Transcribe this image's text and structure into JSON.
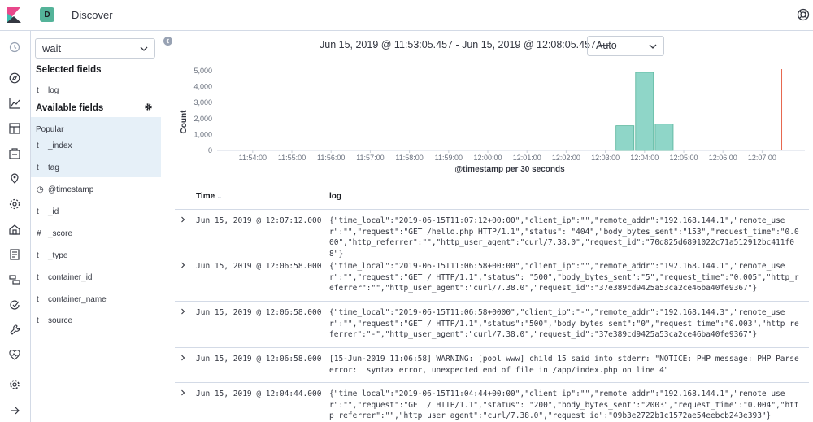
{
  "header": {
    "space_initial": "D",
    "app_title": "Discover"
  },
  "sidebar": {
    "index_pattern": "wait",
    "selected_heading": "Selected fields",
    "selected_fields": [
      {
        "type": "t",
        "name": "log"
      }
    ],
    "available_heading": "Available fields",
    "popular_label": "Popular",
    "popular_fields": [
      {
        "type": "t",
        "name": "_index"
      },
      {
        "type": "t",
        "name": "tag"
      }
    ],
    "other_fields": [
      {
        "type": "◷",
        "name": "@timestamp"
      },
      {
        "type": "t",
        "name": "_id"
      },
      {
        "type": "#",
        "name": "_score"
      },
      {
        "type": "t",
        "name": "_type"
      },
      {
        "type": "t",
        "name": "container_id"
      },
      {
        "type": "t",
        "name": "container_name"
      },
      {
        "type": "t",
        "name": "source"
      }
    ]
  },
  "time_range": {
    "label": "Jun 15, 2019 @ 11:53:05.457 - Jun 15, 2019 @ 12:08:05.457 —",
    "interval": "Auto"
  },
  "chart_data": {
    "type": "bar",
    "ylabel": "Count",
    "xlabel": "@timestamp per 30 seconds",
    "ylim": [
      0,
      5000
    ],
    "yticks": [
      "0",
      "1,000",
      "2,000",
      "3,000",
      "4,000",
      "5,000"
    ],
    "xticks": [
      "11:54:00",
      "11:55:00",
      "11:56:00",
      "11:57:00",
      "11:58:00",
      "11:59:00",
      "12:00:00",
      "12:01:00",
      "12:02:00",
      "12:03:00",
      "12:04:00",
      "12:05:00",
      "12:06:00",
      "12:07:00"
    ],
    "bar_color": "#8fd6c8",
    "bar_border": "#54b399",
    "bars": [
      {
        "x": "12:03:30",
        "value": 1550
      },
      {
        "x": "12:04:00",
        "value": 4900
      },
      {
        "x": "12:04:30",
        "value": 1650
      }
    ],
    "now_marker": "12:07:30",
    "now_color": "#e7664c"
  },
  "table": {
    "col_time": "Time",
    "col_log": "log",
    "rows": [
      {
        "time": "Jun 15, 2019 @ 12:07:12.000",
        "log": "{\"time_local\":\"2019-06-15T11:07:12+00:00\",\"client_ip\":\"\",\"remote_addr\":\"192.168.144.1\",\"remote_user\":\"\",\"request\":\"GET /hello.php HTTP/1.1\",\"status\": \"404\",\"body_bytes_sent\":\"153\",\"request_time\":\"0.000\",\"http_referrer\":\"\",\"http_user_agent\":\"curl/7.38.0\",\"request_id\":\"70d825d6891022c71a512912bc411f08\"}"
      },
      {
        "time": "Jun 15, 2019 @ 12:06:58.000",
        "log": "{\"time_local\":\"2019-06-15T11:06:58+00:00\",\"client_ip\":\"\",\"remote_addr\":\"192.168.144.1\",\"remote_user\":\"\",\"request\":\"GET / HTTP/1.1\",\"status\": \"500\",\"body_bytes_sent\":\"5\",\"request_time\":\"0.005\",\"http_referrer\":\"\",\"http_user_agent\":\"curl/7.38.0\",\"request_id\":\"37e389cd9425a53ca2ce46ba40fe9367\"}"
      },
      {
        "time": "Jun 15, 2019 @ 12:06:58.000",
        "log": "{\"time_local\":\"2019-06-15T11:06:58+0000\",\"client_ip\":\"-\",\"remote_addr\":\"192.168.144.3\",\"remote_user\":\"\",\"request\":\"GET / HTTP/1.1\",\"status\":\"500\",\"body_bytes_sent\":\"0\",\"request_time\":\"0.003\",\"http_referrer\":\"-\",\"http_user_agent\":\"curl/7.38.0\",\"request_id\":\"37e389cd9425a53ca2ce46ba40fe9367\"}"
      },
      {
        "time": "Jun 15, 2019 @ 12:06:58.000",
        "log": "[15-Jun-2019 11:06:58] WARNING: [pool www] child 15 said into stderr: \"NOTICE: PHP message: PHP Parse error:  syntax error, unexpected end of file in /app/index.php on line 4\""
      },
      {
        "time": "Jun 15, 2019 @ 12:04:44.000",
        "log": "{\"time_local\":\"2019-06-15T11:04:44+00:00\",\"client_ip\":\"\",\"remote_addr\":\"192.168.144.1\",\"remote_user\":\"\",\"request\":\"GET / HTTP/1.1\",\"status\": \"200\",\"body_bytes_sent\":\"2003\",\"request_time\":\"0.004\",\"http_referrer\":\"\",\"http_user_agent\":\"curl/7.38.0\",\"request_id\":\"09b3e2722b1c1572ae54eebcb243e393\"}"
      }
    ]
  }
}
